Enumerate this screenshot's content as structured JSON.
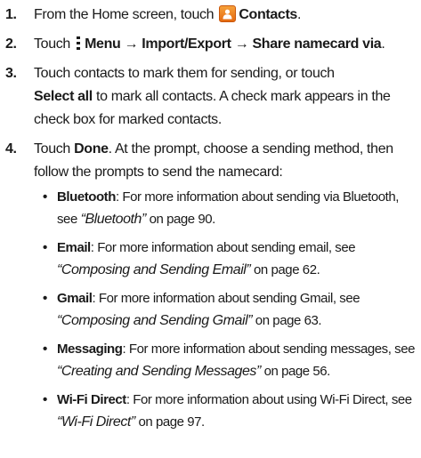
{
  "steps": [
    {
      "number": "1.",
      "pre": "From the Home screen, touch",
      "icon": "contacts-icon",
      "bold": "Contacts",
      "post": "."
    },
    {
      "number": "2.",
      "pre": "Touch",
      "icon": "menu-icon",
      "bold": "Menu → Import/Export → Share namecard via",
      "post": "."
    },
    {
      "number": "3.",
      "pre": "Touch contacts to mark them for sending, or touch",
      "bold": "Select all",
      "post": "to mark all contacts. A check mark appears in the check box for marked contacts."
    },
    {
      "number": "4.",
      "pre": "Touch",
      "bold": "Done",
      "post": ". At the prompt, choose a sending method, then follow the prompts to send the namecard:"
    }
  ],
  "bullets": [
    {
      "label": "Bluetooth",
      "text": ": For more information about sending via Bluetooth, see ",
      "ref": "“Bluetooth”",
      "page": " on page 90."
    },
    {
      "label": "Email",
      "text": ": For more information about sending email, see ",
      "ref": "“Composing and Sending Email”",
      "page": " on page 62."
    },
    {
      "label": "Gmail",
      "text": ": For more information about sending Gmail, see ",
      "ref": "“Composing and Sending Gmail”",
      "page": " on page 63."
    },
    {
      "label": "Messaging",
      "text": ": For more information about sending messages, see ",
      "ref": "“Creating and Sending Messages”",
      "page": " on page 56."
    },
    {
      "label": "Wi-Fi Direct",
      "text": ": For more information about using Wi-Fi Direct, see ",
      "ref": "“Wi-Fi Direct”",
      "page": " on page 97."
    }
  ],
  "bullet_glyph": "•",
  "colors": {
    "text": "#1a1a1a",
    "contacts_icon": "#e8751a"
  }
}
